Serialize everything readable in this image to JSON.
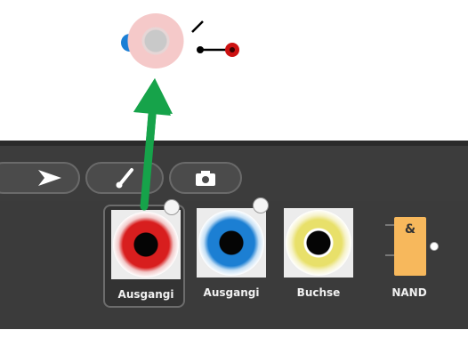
{
  "icons": {
    "drag_ghost": "red-jack-drag-ghost",
    "switch": "switch-icon",
    "arrow": "green-drag-arrow",
    "select": "arrow-pointer-icon",
    "paint": "paintbrush-icon",
    "camera": "camera-icon"
  },
  "colors": {
    "toolbar_bg": "#3c3c3c",
    "palette_bg": "#3b3b3b",
    "drag_arrow": "#16a34a",
    "switch_led": "#cc1111"
  },
  "palette": {
    "items": [
      {
        "label": "Ausgangi",
        "kind": "jack",
        "color": "red",
        "selected": true
      },
      {
        "label": "Ausgangi",
        "kind": "jack",
        "color": "blue",
        "selected": false
      },
      {
        "label": "Buchse",
        "kind": "jack",
        "color": "yellow",
        "selected": false
      },
      {
        "label": "NAND",
        "kind": "gate",
        "symbol": "&",
        "selected": false
      }
    ]
  }
}
